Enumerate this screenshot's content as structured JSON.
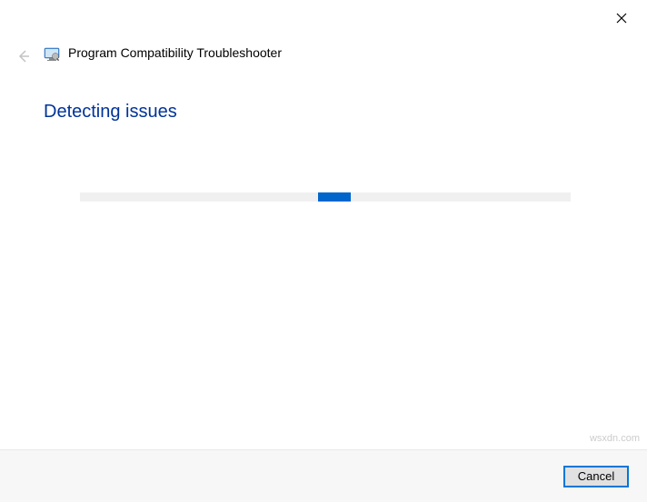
{
  "window": {
    "title": "Program Compatibility Troubleshooter"
  },
  "main": {
    "heading": "Detecting issues"
  },
  "footer": {
    "cancel_label": "Cancel"
  },
  "watermark": "wsxdn.com"
}
